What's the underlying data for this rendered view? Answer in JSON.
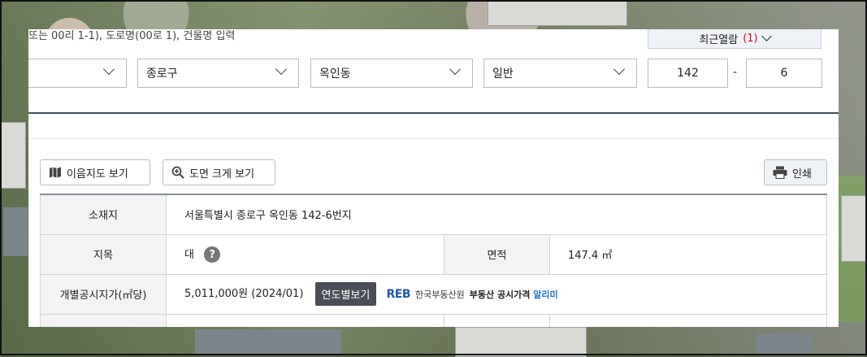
{
  "search": {
    "placeholder_text": "또는 00리 1-1), 도로명(00로 1), 건물명 입력",
    "recent_label": "최근열람",
    "recent_count": "(1)"
  },
  "address_selects": {
    "sido": "",
    "sigungu": "종로구",
    "dong": "옥인동",
    "type": "일반"
  },
  "lot_number": {
    "main": "142",
    "separator": "-",
    "sub": "6"
  },
  "toolbar": {
    "map_button": "이음지도 보기",
    "zoom_button": "도면 크게 보기",
    "print_button": "인쇄"
  },
  "info_table": {
    "location_label": "소재지",
    "location_value": "서울특별시 종로구 옥인동 142-6번지",
    "land_category_label": "지목",
    "land_category_value": "대",
    "help_glyph": "?",
    "area_label": "면적",
    "area_value": "147.4 ㎡",
    "price_label": "개별공시지가(㎡당)",
    "price_value": "5,011,000원 (2024/01)",
    "year_button": "연도별보기",
    "reb_logo": "REB",
    "reb_org": "한국부동산원",
    "reb_service_prefix": "부동산 공시가격",
    "reb_service_highlight": "알리미"
  }
}
